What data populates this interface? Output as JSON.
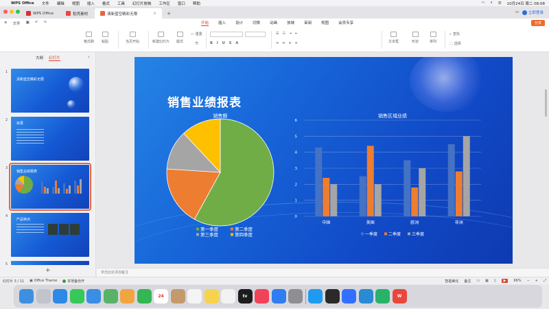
{
  "menubar": {
    "items": [
      "WPS Office",
      "文件",
      "编辑",
      "视图",
      "插入",
      "格式",
      "工具",
      "幻灯片放映",
      "工作区",
      "窗口",
      "帮助"
    ],
    "datetime": "10月24日 周二 08:08"
  },
  "tabs": [
    {
      "label": "WPS Office",
      "color": "#d9302c"
    },
    {
      "label": "稻壳素材",
      "color": "#e8473c"
    },
    {
      "label": "清新蓝空精彩无限",
      "color": "#e8663d"
    }
  ],
  "account": {
    "login": "立即登录"
  },
  "ribbon": {
    "file": "文件",
    "tabs": [
      "开始",
      "插入",
      "设计",
      "切换",
      "动画",
      "放映",
      "审阅",
      "视图",
      "会员专享"
    ],
    "active": "开始",
    "share": "分享"
  },
  "toolbar": {
    "groups": [
      "格式刷",
      "粘贴",
      "当页开始",
      "新建幻灯片",
      "版式",
      "节",
      "文本框",
      "形状",
      "排列",
      "查找",
      "选择"
    ],
    "reset": "重置"
  },
  "sidebar": {
    "tabs": [
      "大纲",
      "幻灯片"
    ],
    "active_tab": "幻灯片",
    "slides": [
      {
        "num": "1",
        "title": "清新蓝空精彩无限"
      },
      {
        "num": "2",
        "title": "目录"
      },
      {
        "num": "3",
        "title": "销售业绩报表"
      },
      {
        "num": "4",
        "title": "产品特点"
      },
      {
        "num": "5",
        "title": ""
      }
    ]
  },
  "slide": {
    "title": "销售业绩报表"
  },
  "chart_data": [
    {
      "type": "pie",
      "title": "销售额",
      "categories": [
        "第一季度",
        "第二季度",
        "第三季度",
        "第四季度"
      ],
      "values": [
        58,
        18,
        12,
        12
      ],
      "colors": [
        "#70ad47",
        "#ed7d31",
        "#a5a5a5",
        "#ffc000"
      ]
    },
    {
      "type": "bar",
      "title": "销售区域业绩",
      "categories": [
        "中国",
        "美国",
        "欧洲",
        "非洲"
      ],
      "ylim": [
        0,
        6
      ],
      "yticks": [
        0,
        1,
        2,
        3,
        4,
        5,
        6
      ],
      "series": [
        {
          "name": "一季度",
          "values": [
            4.3,
            2.5,
            3.5,
            4.5
          ],
          "color": "#4472c4"
        },
        {
          "name": "二季度",
          "values": [
            2.4,
            4.4,
            1.8,
            2.8
          ],
          "color": "#ed7d31"
        },
        {
          "name": "三季度",
          "values": [
            2.0,
            2.0,
            3.0,
            5.0
          ],
          "color": "#a5a5a5"
        }
      ]
    }
  ],
  "notes": {
    "placeholder": "单击此处添加备注"
  },
  "status": {
    "slide_count": "幻灯片 3 / 11",
    "theme": "Office Theme",
    "backup": "本地备份开",
    "smart": "智能美化",
    "notes": "备注",
    "zoom": "66%"
  },
  "dock": {
    "apps": [
      {
        "name": "finder",
        "color": "#3d8fe0"
      },
      {
        "name": "launchpad",
        "color": "#c0c4cc"
      },
      {
        "name": "safari",
        "color": "#2d89e5"
      },
      {
        "name": "messages",
        "color": "#36c85a"
      },
      {
        "name": "mail",
        "color": "#3a8ee6"
      },
      {
        "name": "maps",
        "color": "#58b368"
      },
      {
        "name": "photos",
        "color": "#f1a540"
      },
      {
        "name": "facetime",
        "color": "#34b653"
      },
      {
        "name": "calendar",
        "color": "#ffffff",
        "text": "24"
      },
      {
        "name": "contacts",
        "color": "#c49a6c"
      },
      {
        "name": "reminders",
        "color": "#f4f4f4"
      },
      {
        "name": "notes",
        "color": "#f7d24c"
      },
      {
        "name": "freeform",
        "color": "#f2f2f2"
      },
      {
        "name": "appletv",
        "color": "#1c1c1e",
        "text": "tv"
      },
      {
        "name": "music",
        "color": "#f0435a"
      },
      {
        "name": "appstore",
        "color": "#2f7df0"
      },
      {
        "name": "settings",
        "color": "#8e8e93"
      },
      {
        "name": "qq",
        "color": "#1e9bf0"
      },
      {
        "name": "terminal",
        "color": "#2a2a2a"
      },
      {
        "name": "feishu",
        "color": "#3370ff"
      },
      {
        "name": "vscode",
        "color": "#2a8ad4"
      },
      {
        "name": "infuse",
        "color": "#27b36a"
      },
      {
        "name": "wps",
        "color": "#e8473c",
        "text": "W"
      }
    ]
  }
}
